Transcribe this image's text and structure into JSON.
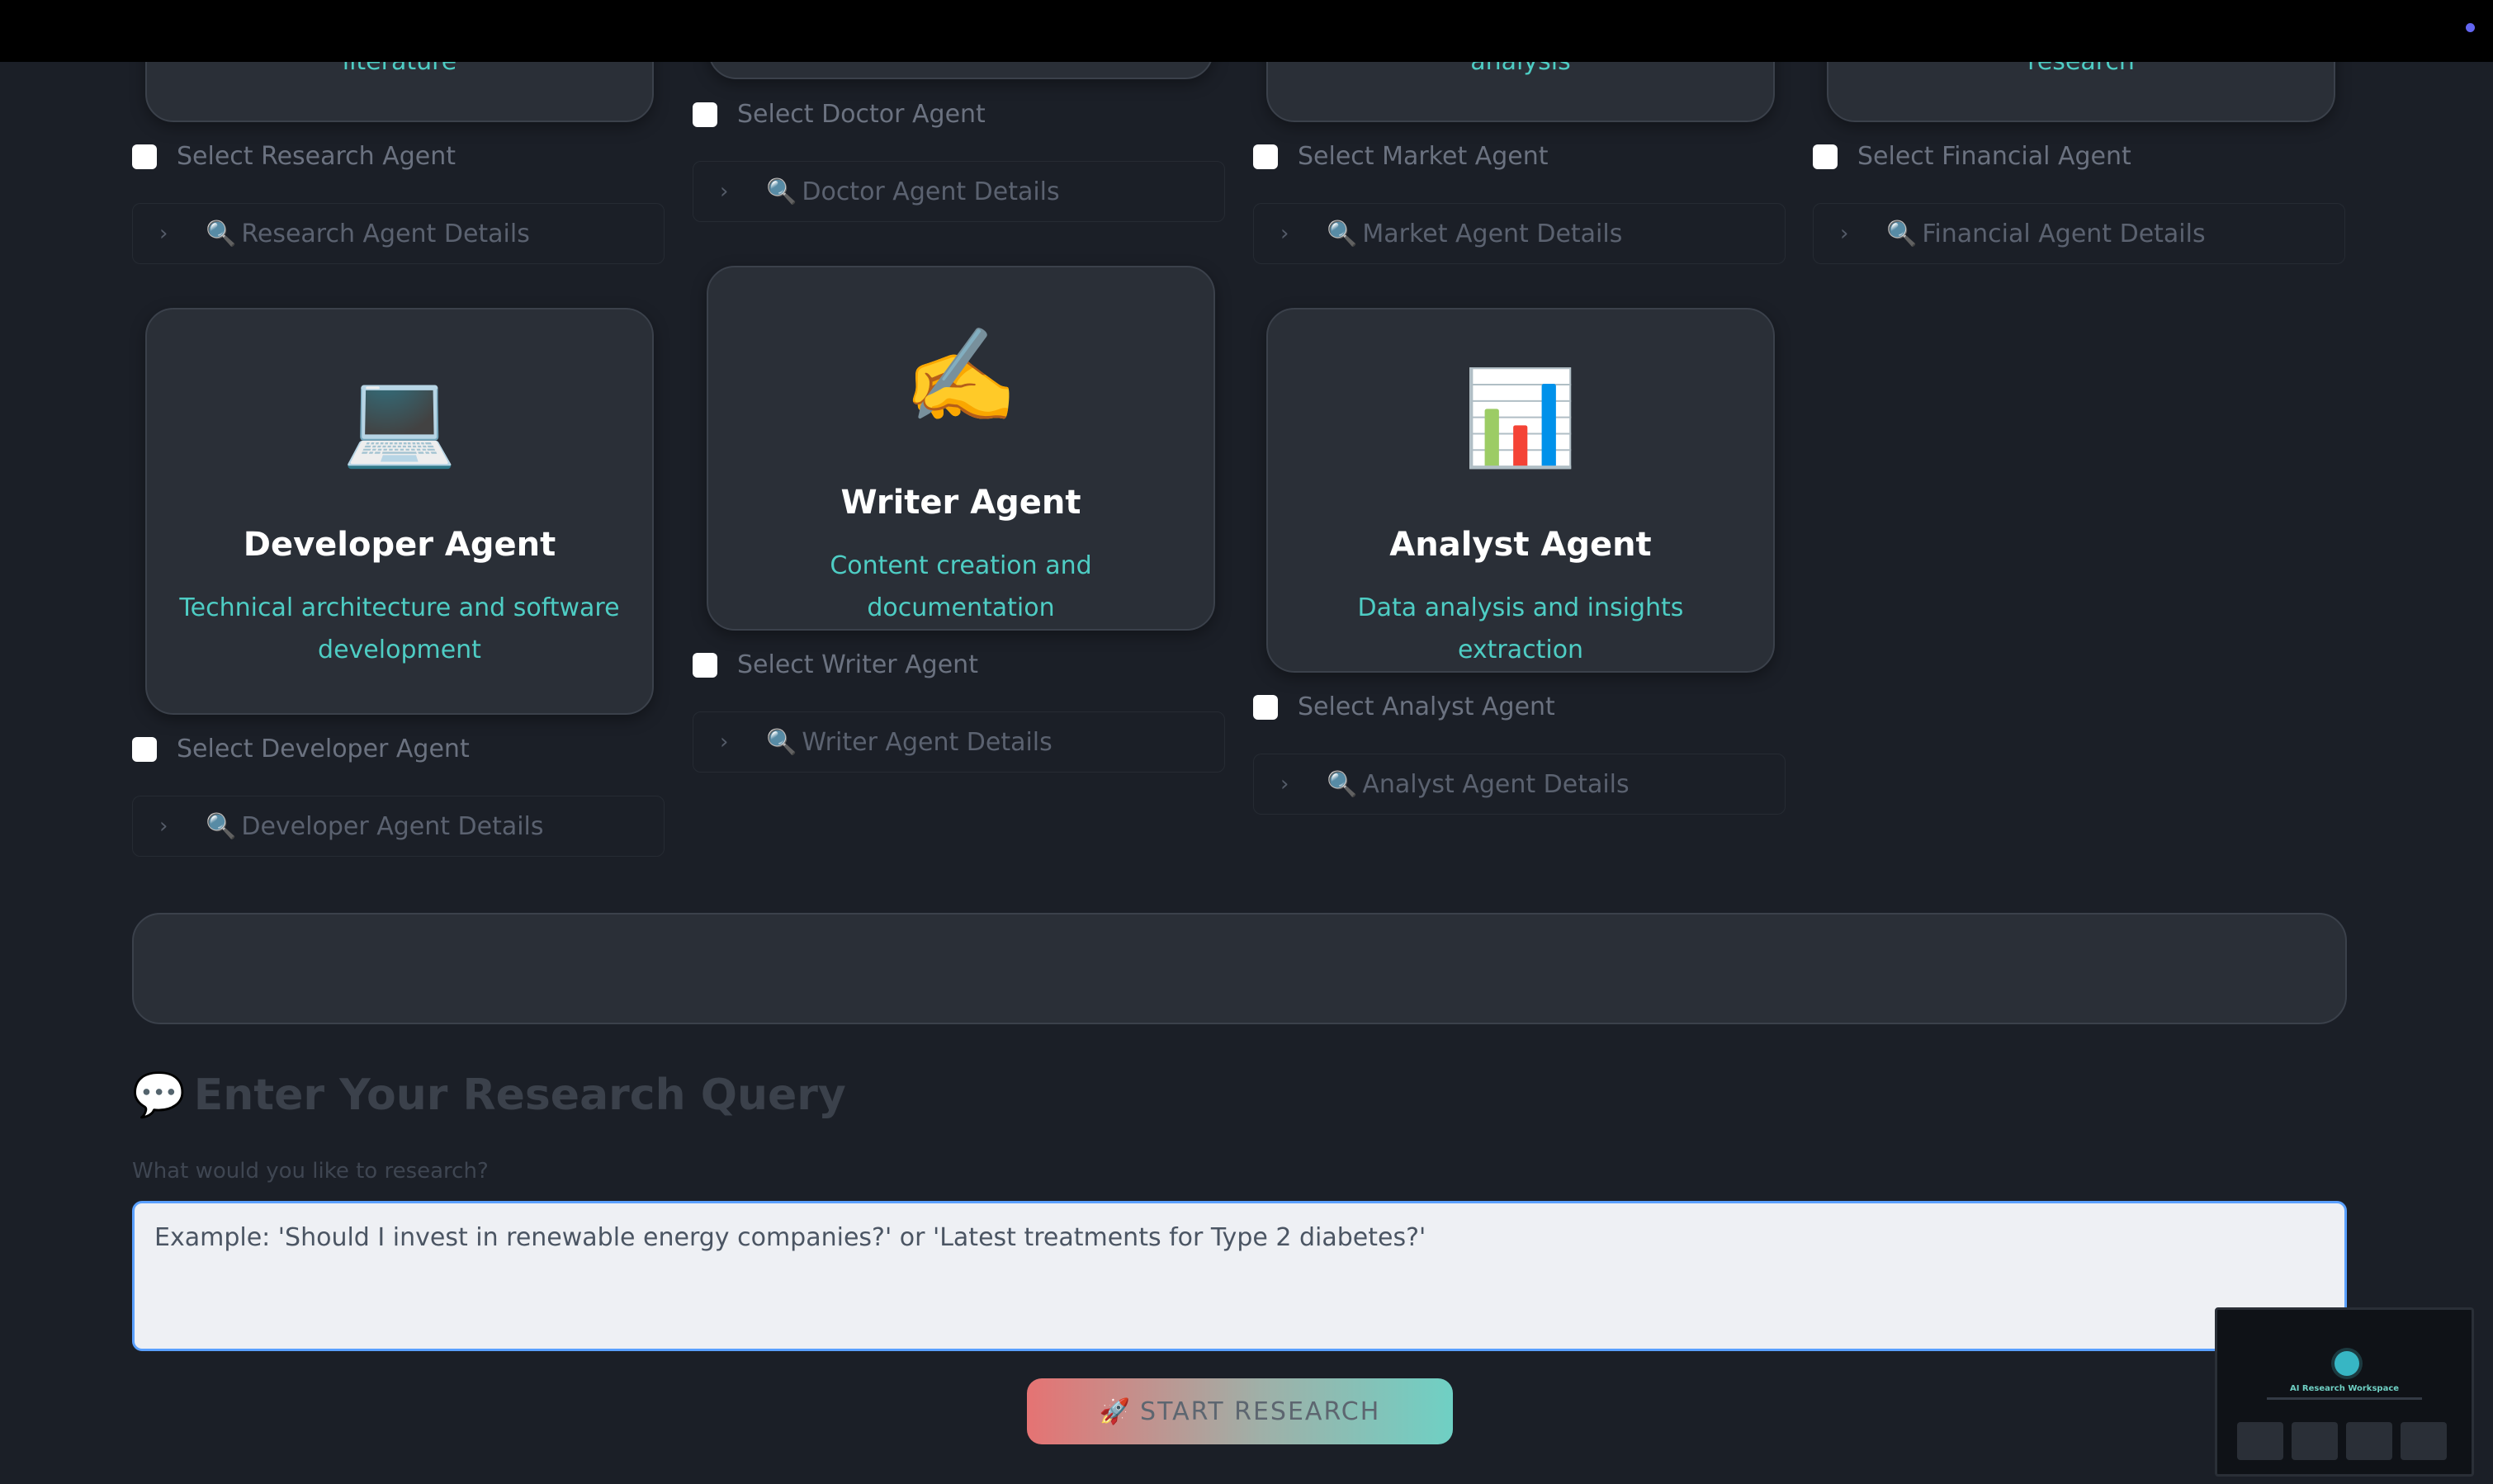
{
  "top_row": {
    "cards": [
      {
        "desc_fragment": "literature",
        "checkbox_label": "Select Research Agent",
        "details_label": "Research Agent Details"
      },
      {
        "desc_fragment": "",
        "checkbox_label": "Select Doctor Agent",
        "details_label": "Doctor Agent Details"
      },
      {
        "desc_fragment": "analysis",
        "checkbox_label": "Select Market Agent",
        "details_label": "Market Agent Details"
      },
      {
        "desc_fragment": "research",
        "checkbox_label": "Select Financial Agent",
        "details_label": "Financial Agent Details"
      }
    ]
  },
  "agents": [
    {
      "icon": "💻",
      "icon_name": "laptop-icon",
      "title": "Developer Agent",
      "desc": "Technical architecture and software development",
      "checkbox_label": "Select Developer Agent",
      "details_label": "Developer Agent Details"
    },
    {
      "icon": "✍️",
      "icon_name": "writing-hand-icon",
      "title": "Writer Agent",
      "desc": "Content creation and documentation",
      "checkbox_label": "Select Writer Agent",
      "details_label": "Writer Agent Details"
    },
    {
      "icon": "📊",
      "icon_name": "bar-chart-icon",
      "title": "Analyst Agent",
      "desc": "Data analysis and insights extraction",
      "checkbox_label": "Select Analyst Agent",
      "details_label": "Analyst Agent Details"
    }
  ],
  "query": {
    "heading_icon": "💬",
    "heading": "Enter Your Research Query",
    "label": "What would you like to research?",
    "placeholder": "Example: 'Should I invest in renewable energy companies?' or 'Latest treatments for Type 2 diabetes?'"
  },
  "start_button": {
    "icon": "🚀",
    "label": "START RESEARCH"
  },
  "thumbnail": {
    "title": "AI Research Workspace"
  },
  "icons": {
    "magnifier": "🔍",
    "chevron": "›"
  },
  "colors": {
    "accent": "#4ecdc4",
    "card_bg": "#2a2f37",
    "page_bg": "#1b1f27",
    "status_dot": "#6366f1"
  }
}
